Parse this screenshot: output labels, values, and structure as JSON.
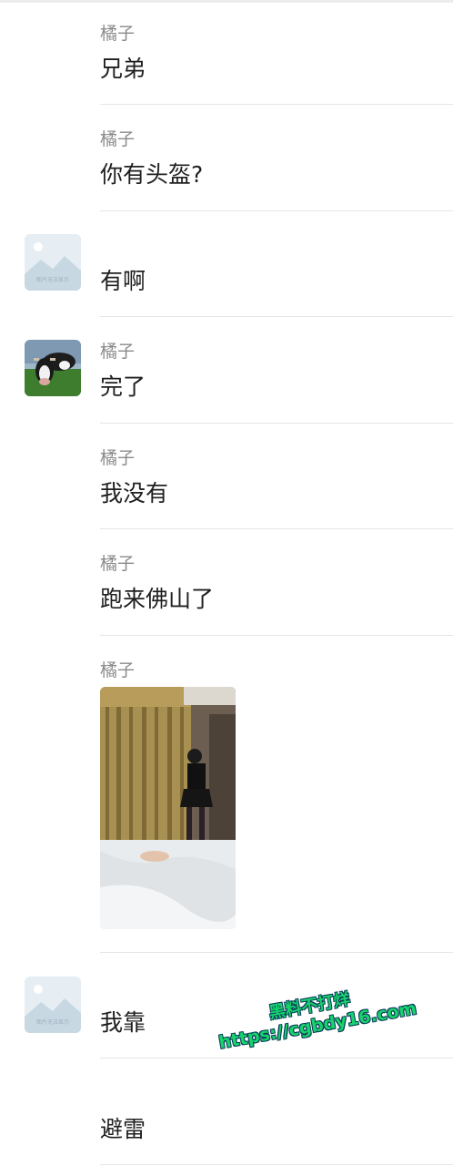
{
  "messages": [
    {
      "sender": "橘子",
      "text": "兄弟"
    },
    {
      "sender": "橘子",
      "text": "你有头盔?"
    },
    {
      "sender": "",
      "text": "有啊",
      "avatar_caption": "图片无法显示"
    },
    {
      "sender": "橘子",
      "text": "完了"
    },
    {
      "sender": "橘子",
      "text": "我没有"
    },
    {
      "sender": "橘子",
      "text": "跑来佛山了"
    },
    {
      "sender": "橘子",
      "image": "photo-of-room"
    },
    {
      "sender": "",
      "text": "我靠",
      "avatar_caption": "图片无法显示"
    },
    {
      "sender": "",
      "text": "避雷"
    }
  ],
  "watermark": {
    "line1": "黑料不打烊",
    "line2": "https://cgbdy16.com"
  },
  "icons": {
    "placeholder": "image-placeholder-icon",
    "cow_avatar": "cow-avatar-icon"
  }
}
